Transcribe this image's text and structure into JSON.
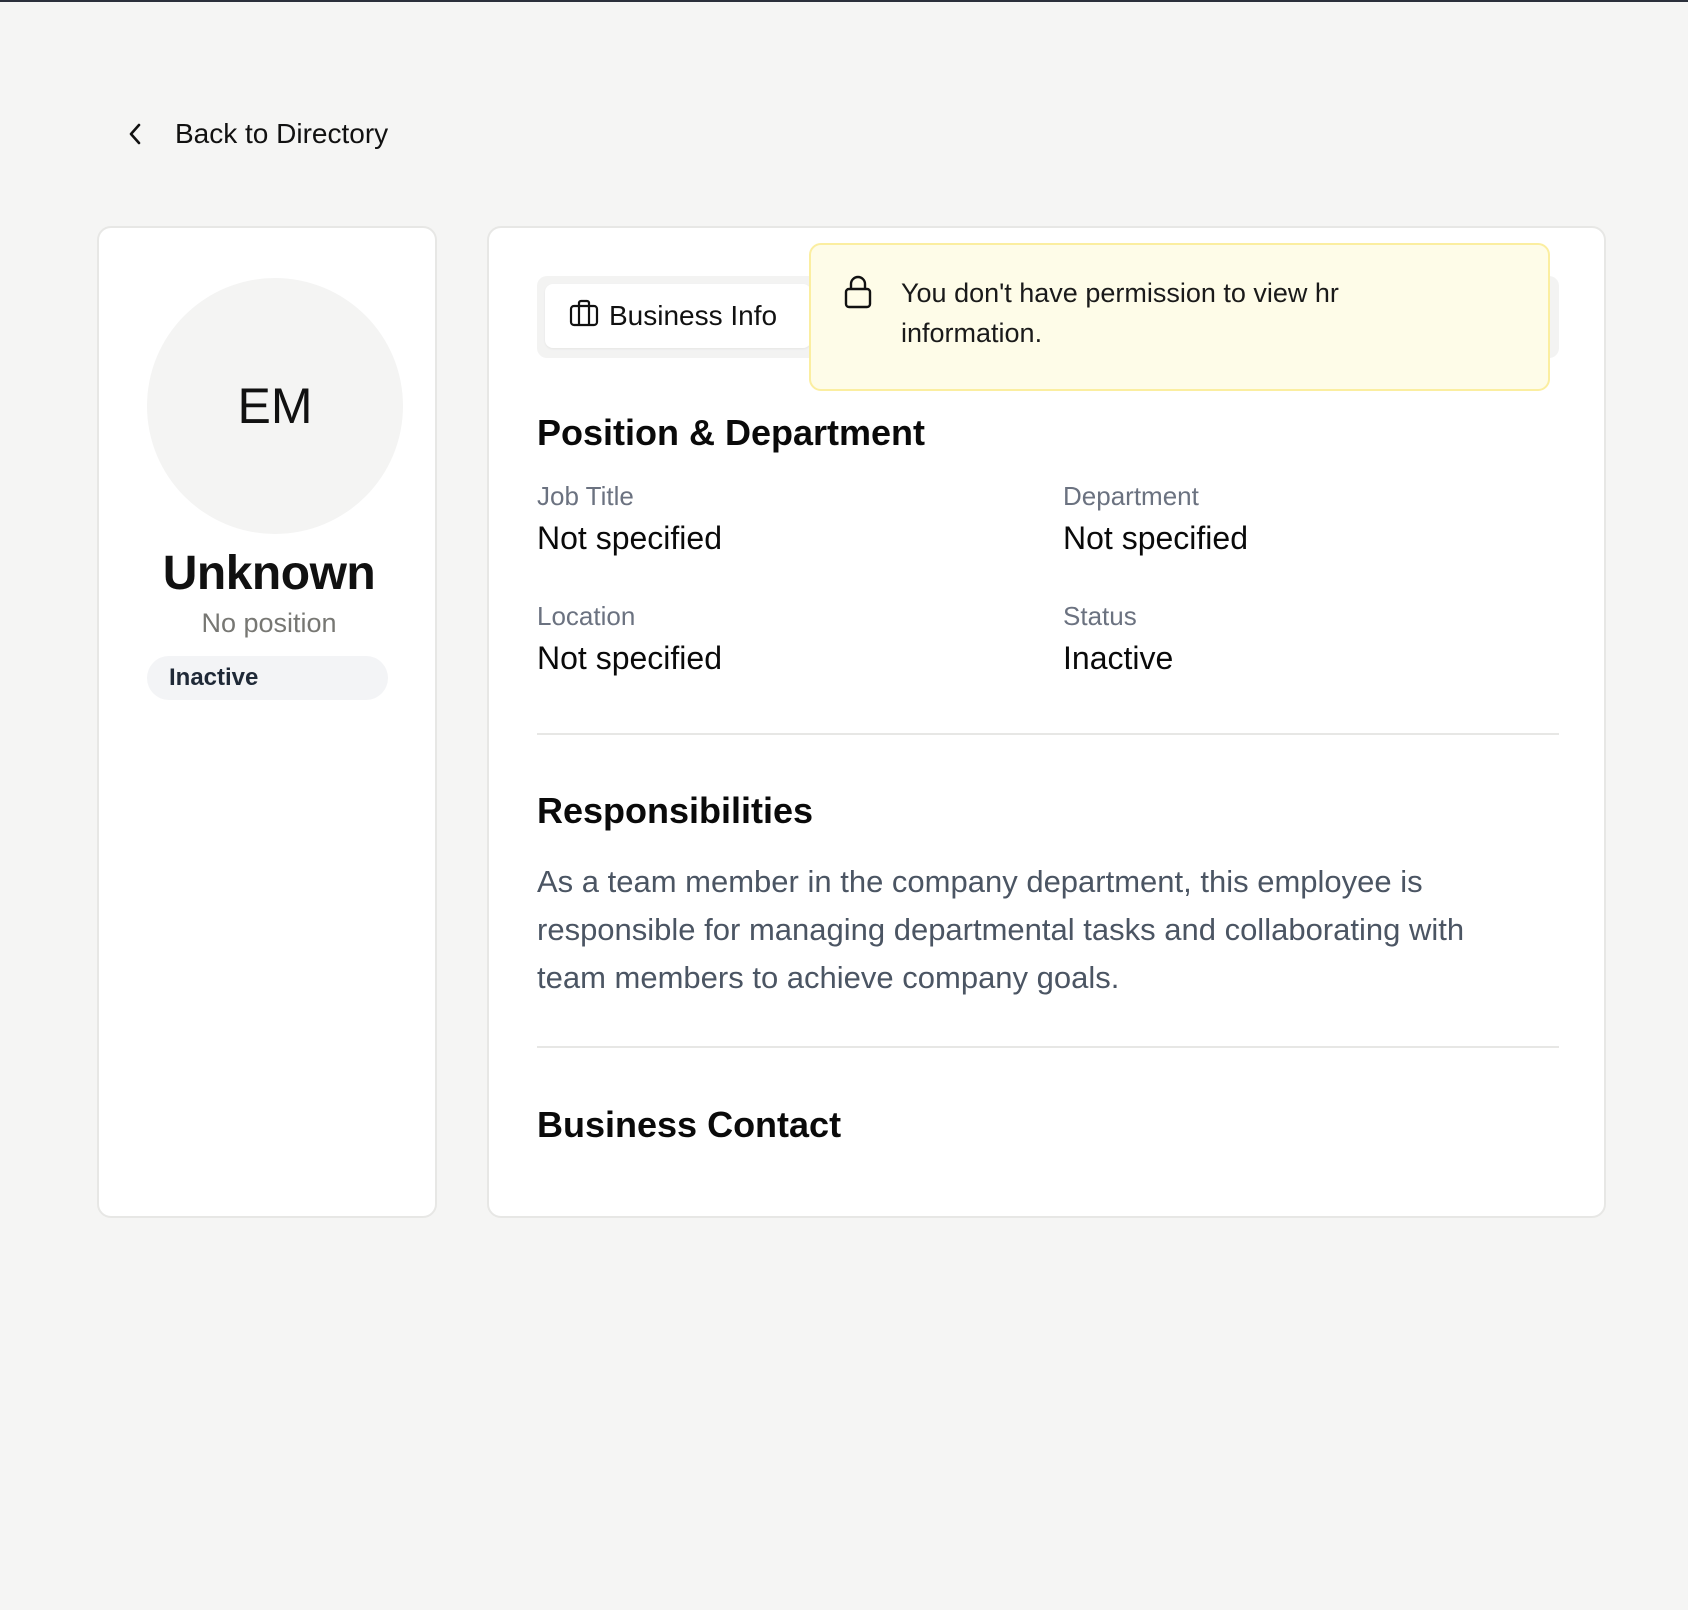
{
  "nav": {
    "back_label": "Back to Directory"
  },
  "profile": {
    "initials": "EM",
    "name": "Unknown",
    "position": "No position",
    "status": "Inactive"
  },
  "tabs": {
    "active_label": "Business Info",
    "active_icon": "briefcase-icon"
  },
  "notice": {
    "icon": "lock-icon",
    "message": "You don't have permission to view hr information.",
    "background": "#fefce8",
    "border": "#fbeea0"
  },
  "position_section": {
    "title": "Position & Department",
    "fields": [
      {
        "label": "Job Title",
        "value": "Not specified"
      },
      {
        "label": "Department",
        "value": "Not specified"
      },
      {
        "label": "Location",
        "value": "Not specified"
      },
      {
        "label": "Status",
        "value": "Inactive"
      }
    ]
  },
  "responsibilities": {
    "title": "Responsibilities",
    "text": "As a team member in the company department, this employee is responsible for managing departmental tasks and collaborating with team members to achieve company goals."
  },
  "contact": {
    "title": "Business Contact"
  }
}
